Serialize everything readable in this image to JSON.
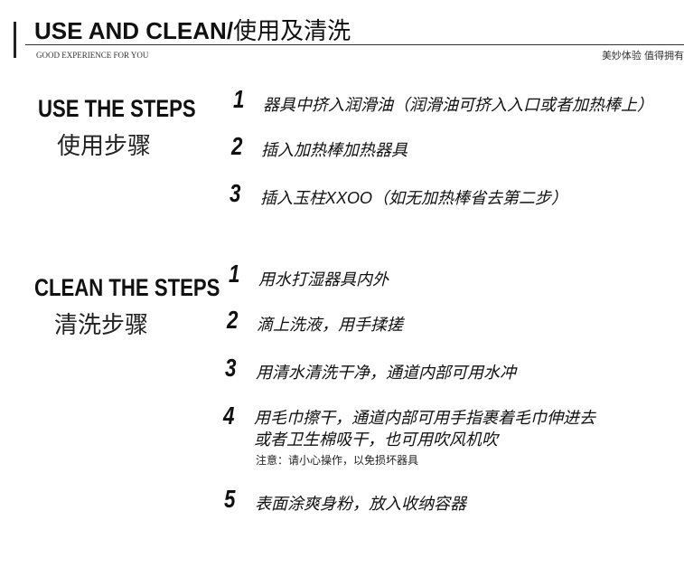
{
  "header": {
    "title_en": "USE AND CLEAN/",
    "title_cn": "使用及清洗",
    "subtitle": "GOOD EXPERIENCE FOR YOU",
    "tagline": "美妙体验  值得拥有"
  },
  "use": {
    "title_en": "USE THE STEPS",
    "title_cn": "使用步骤",
    "steps": [
      {
        "num": "1",
        "text": "器具中挤入润滑油（润滑油可挤入入口或者加热棒上）"
      },
      {
        "num": "2",
        "text": "插入加热棒加热器具"
      },
      {
        "num": "3",
        "text": "插入玉柱XXOO（如无加热棒省去第二步）"
      }
    ]
  },
  "clean": {
    "title_en": "CLEAN THE STEPS",
    "title_cn": "清洗步骤",
    "steps": [
      {
        "num": "1",
        "text": "用水打湿器具内外"
      },
      {
        "num": "2",
        "text": "滴上洗液，用手揉搓"
      },
      {
        "num": "3",
        "text": "用清水清洗干净，通道内部可用水冲"
      },
      {
        "num": "4",
        "text": "用毛巾擦干，通道内部可用手指裹着毛巾伸进去",
        "text2": "或者卫生棉吸干，也可用吹风机吹"
      },
      {
        "num": "5",
        "text": "表面涂爽身粉，放入收纳容器"
      }
    ],
    "note": "注意：请小心操作，以免损坏器具"
  }
}
